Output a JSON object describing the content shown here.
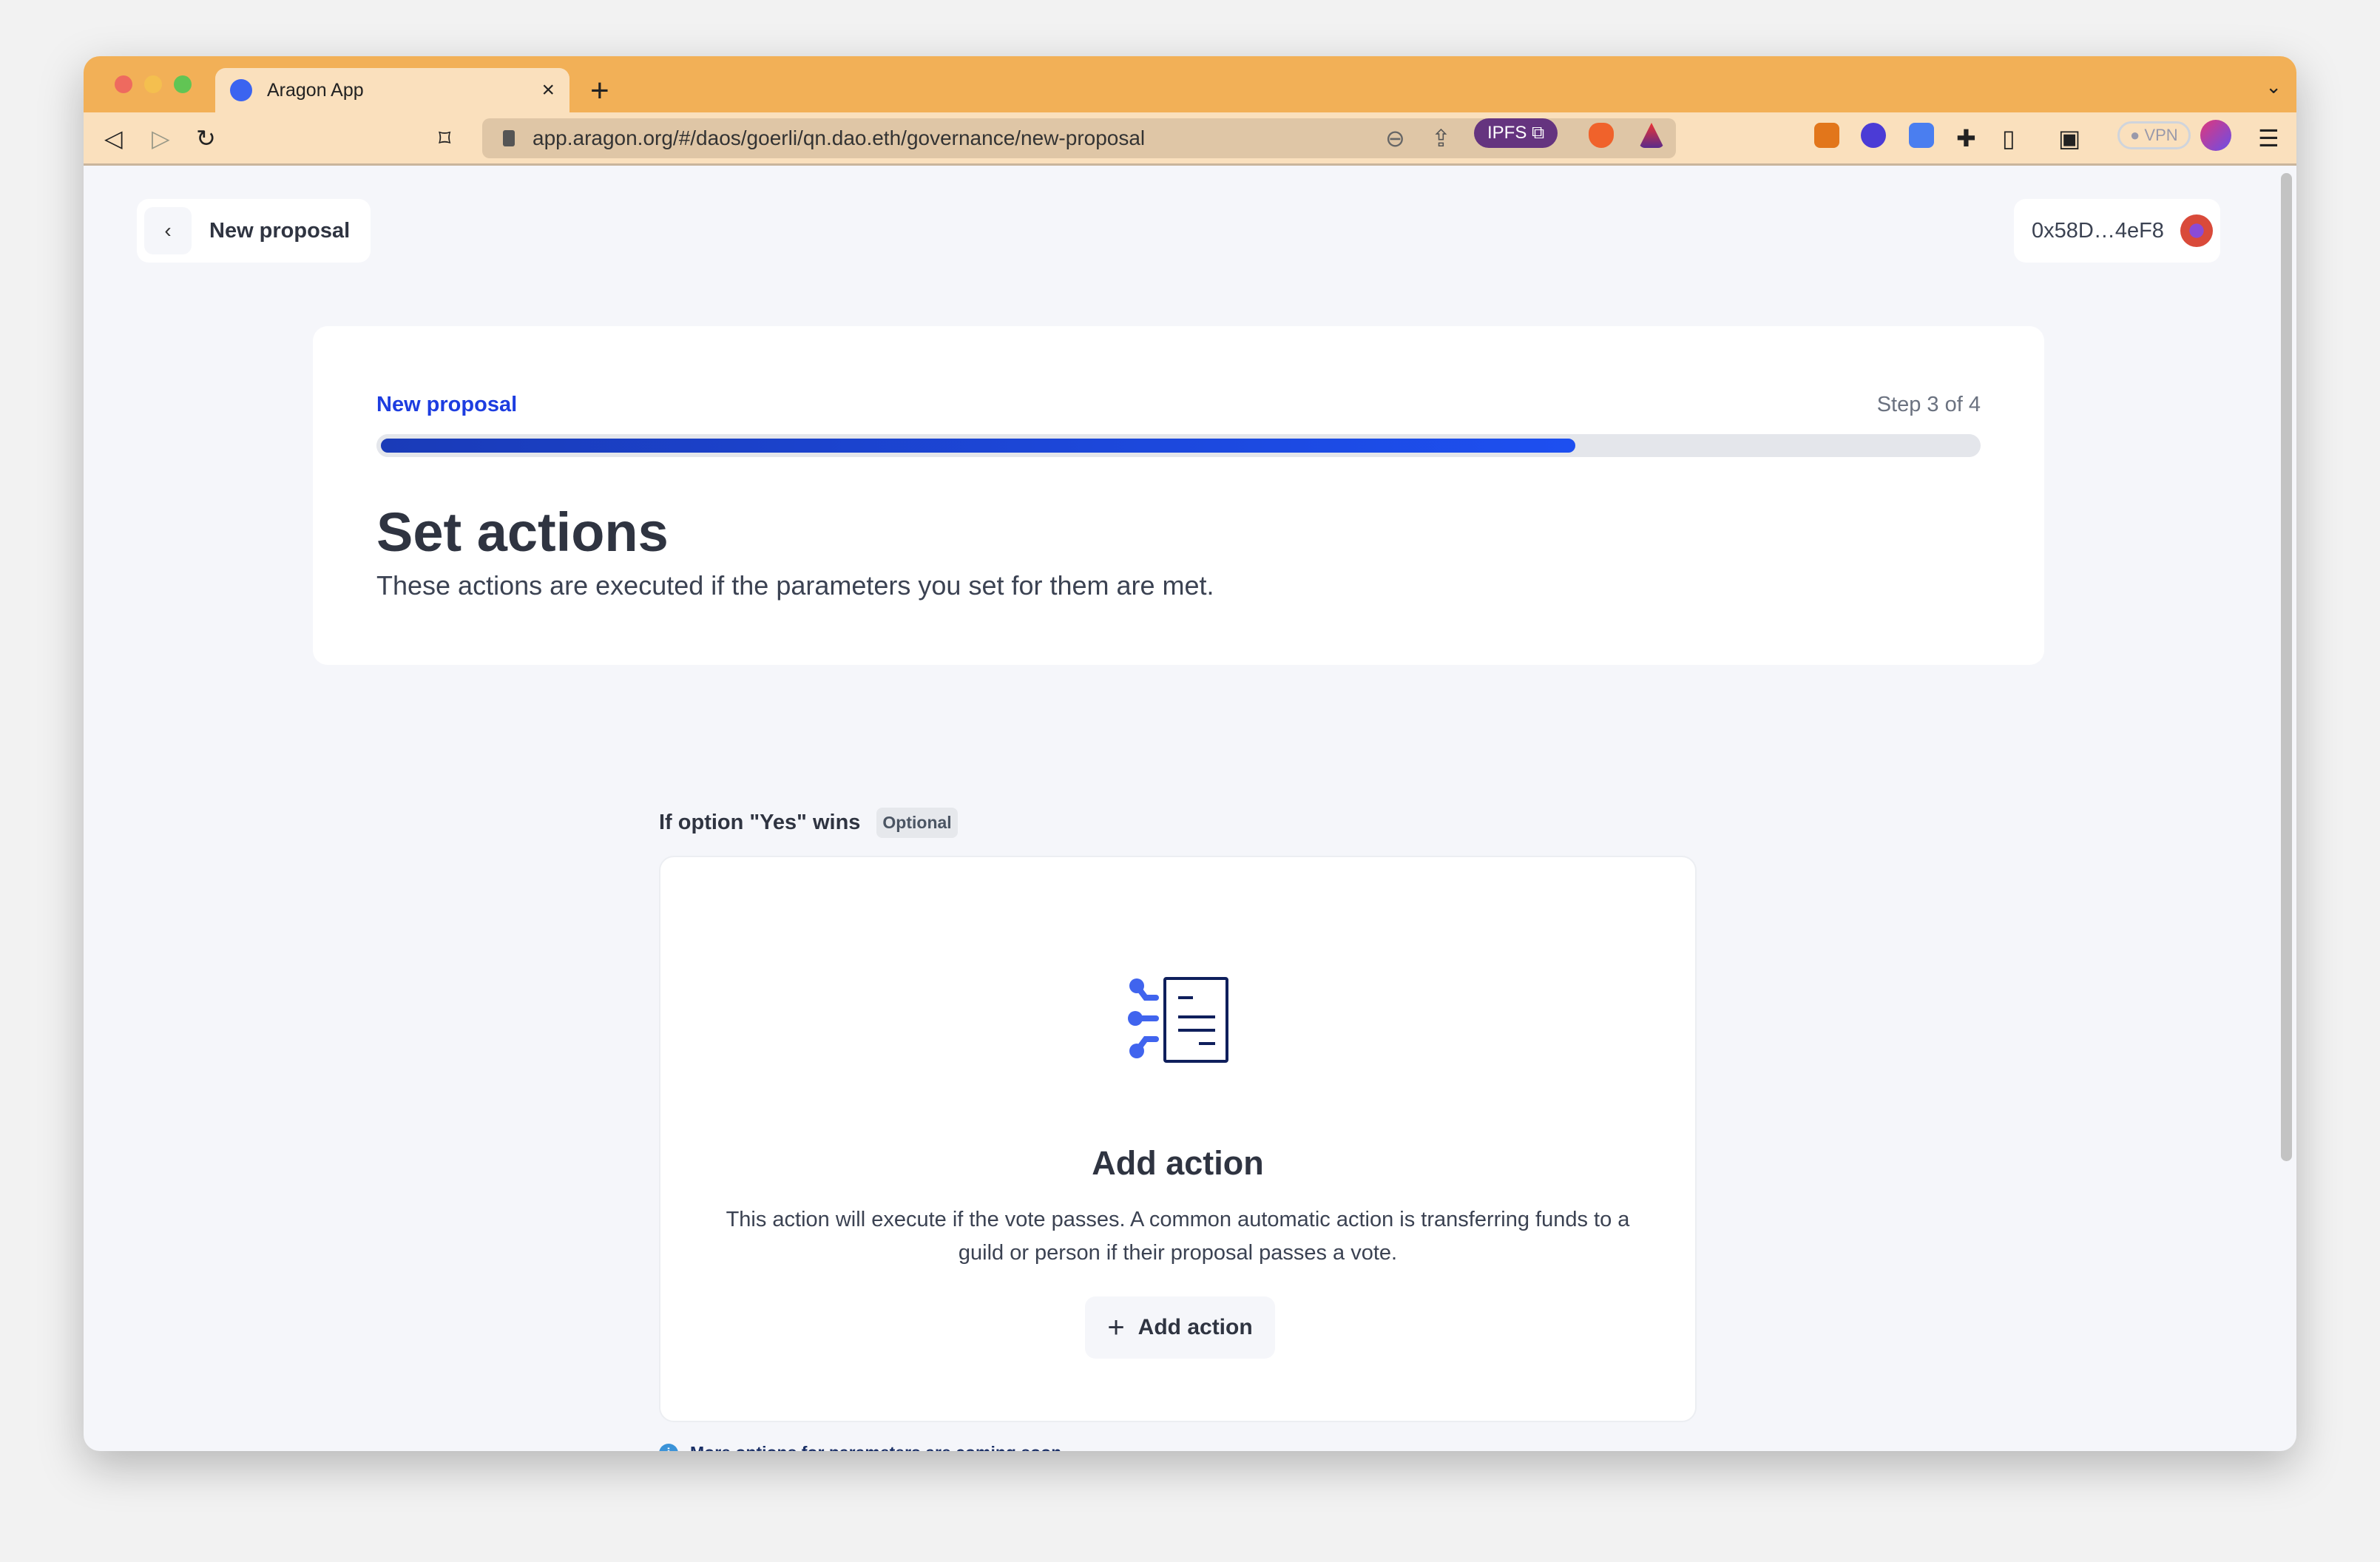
{
  "browser": {
    "tab_title": "Aragon App",
    "url": "app.aragon.org/#/daos/goerli/qn.dao.eth/governance/new-proposal",
    "ipfs_label": "IPFS",
    "vpn_label": "VPN"
  },
  "header": {
    "back_title": "New proposal",
    "wallet_address": "0x58D…4eF8"
  },
  "wizard": {
    "label": "New proposal",
    "step": "Step 3 of 4",
    "progress": 0.75,
    "title": "Set actions",
    "subtitle": "These actions are executed if the parameters you set for them are met."
  },
  "section": {
    "title": "If option \"Yes\" wins",
    "badge": "Optional",
    "empty_title": "Add action",
    "empty_desc": "This action will execute if the vote passes. A common automatic action is transferring funds to a guild or person if their proposal passes a vote.",
    "button_label": "Add action",
    "note": "More options for parameters are coming soon."
  },
  "colors": {
    "accent": "#1d3de0",
    "titlebar": "#f2b057",
    "toolbar": "#fae0bd"
  }
}
